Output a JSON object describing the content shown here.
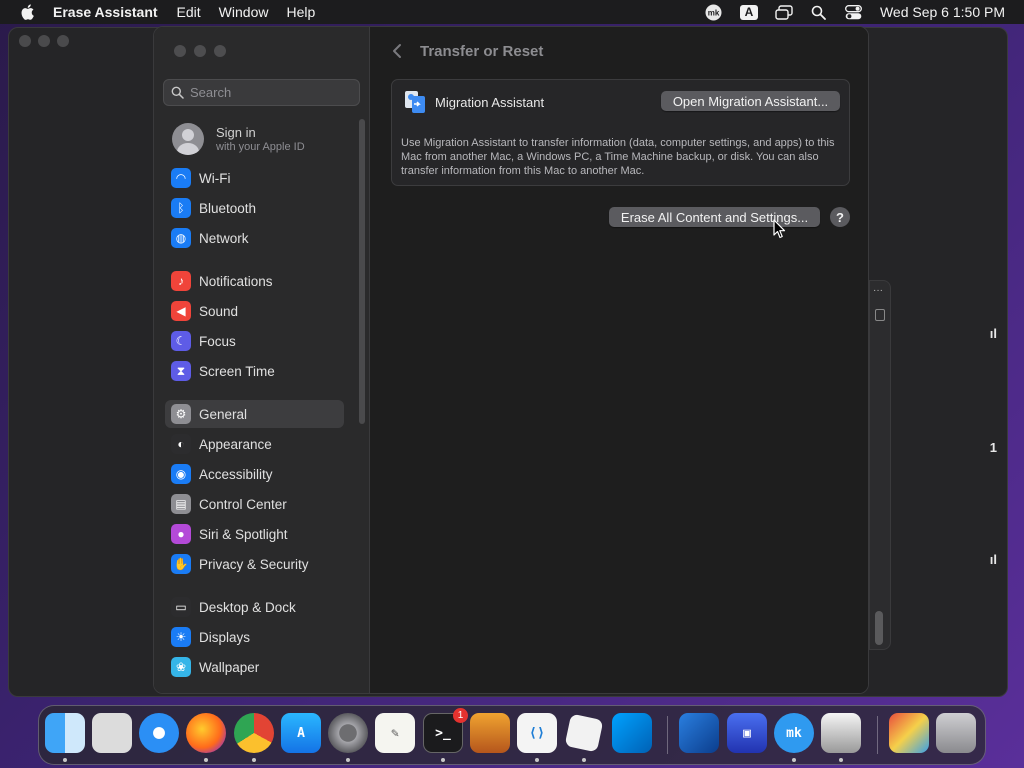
{
  "menubar": {
    "apple_icon": "apple-icon",
    "app_name": "Erase Assistant",
    "menus": [
      "Edit",
      "Window",
      "Help"
    ],
    "status_icons": [
      "mk-icon",
      "input-source-icon",
      "screen-mirroring-icon",
      "search-icon",
      "control-center-icon"
    ],
    "input_source_label": "A",
    "datetime": "Wed Sep 6  1:50 PM"
  },
  "background_window": {
    "edge_glyphs": [
      "ıl",
      "1",
      "ıl"
    ]
  },
  "settings": {
    "search": {
      "placeholder": "Search"
    },
    "signin": {
      "title": "Sign in",
      "subtitle": "with your Apple ID"
    },
    "sidebar_items": [
      {
        "label": "Wi-Fi",
        "icon": "wifi-icon",
        "color": "#1a7cf5"
      },
      {
        "label": "Bluetooth",
        "icon": "bluetooth-icon",
        "color": "#1a7cf5"
      },
      {
        "label": "Network",
        "icon": "globe-icon",
        "color": "#1a7cf5"
      },
      {
        "label": "Notifications",
        "icon": "bell-icon",
        "color": "#f0443a"
      },
      {
        "label": "Sound",
        "icon": "speaker-icon",
        "color": "#f0443a"
      },
      {
        "label": "Focus",
        "icon": "moon-icon",
        "color": "#5e5ce6"
      },
      {
        "label": "Screen Time",
        "icon": "hourglass-icon",
        "color": "#5e5ce6"
      },
      {
        "label": "General",
        "icon": "gear-icon",
        "color": "#8e8e93",
        "selected": true
      },
      {
        "label": "Appearance",
        "icon": "appearance-icon",
        "color": "#2c2c2e"
      },
      {
        "label": "Accessibility",
        "icon": "accessibility-icon",
        "color": "#1a7cf5"
      },
      {
        "label": "Control Center",
        "icon": "control-center-icon",
        "color": "#8e8e93"
      },
      {
        "label": "Siri & Spotlight",
        "icon": "siri-icon",
        "color": "#b44ad8"
      },
      {
        "label": "Privacy & Security",
        "icon": "hand-icon",
        "color": "#1a7cf5"
      },
      {
        "label": "Desktop & Dock",
        "icon": "dock-icon",
        "color": "#2c2c2e"
      },
      {
        "label": "Displays",
        "icon": "sun-icon",
        "color": "#1a7cf5"
      },
      {
        "label": "Wallpaper",
        "icon": "wallpaper-icon",
        "color": "#35b5e8"
      }
    ],
    "content": {
      "title": "Transfer or Reset",
      "migration": {
        "title": "Migration Assistant",
        "button": "Open Migration Assistant...",
        "description": "Use Migration Assistant to transfer information (data, computer settings, and apps) to this Mac from another Mac, a Windows PC, a Time Machine backup, or disk. You can also transfer information from this Mac to another Mac."
      },
      "erase_button": "Erase All Content and Settings...",
      "help_label": "?"
    }
  },
  "dock": {
    "items": [
      {
        "name": "Finder",
        "icon": "finder-icon",
        "running": true
      },
      {
        "name": "Launchpad",
        "icon": "launchpad-icon",
        "running": false
      },
      {
        "name": "Safari",
        "icon": "safari-icon",
        "running": false
      },
      {
        "name": "Firefox",
        "icon": "firefox-icon",
        "running": true
      },
      {
        "name": "Chrome",
        "icon": "chrome-icon",
        "running": true
      },
      {
        "name": "App Store",
        "icon": "app-store-icon",
        "running": false
      },
      {
        "name": "System Settings",
        "icon": "system-settings-icon",
        "running": true
      },
      {
        "name": "TextEdit",
        "icon": "textedit-icon",
        "running": false
      },
      {
        "name": "Terminal",
        "icon": "terminal-icon",
        "running": true,
        "badge": "1"
      },
      {
        "name": "GarageBand",
        "icon": "guitar-icon",
        "running": false
      },
      {
        "name": "Visual Studio Code",
        "icon": "vscode-icon",
        "running": true
      },
      {
        "name": "Roblox",
        "icon": "roblox-icon",
        "running": true
      },
      {
        "name": "Roblox Studio",
        "icon": "roblox-studio-icon",
        "running": false
      },
      {
        "name": "Screen Sharing",
        "icon": "screen-sharing-icon",
        "running": false
      },
      {
        "name": "Screen Frame",
        "icon": "frame-icon",
        "running": false
      },
      {
        "name": "MacKeeper",
        "icon": "mk-icon",
        "running": true
      },
      {
        "name": "Bartender",
        "icon": "bartender-icon",
        "running": true
      },
      {
        "name": "Photos Folder",
        "icon": "folder-stack-icon",
        "running": false
      },
      {
        "name": "Trash",
        "icon": "trash-icon",
        "running": false
      }
    ]
  }
}
